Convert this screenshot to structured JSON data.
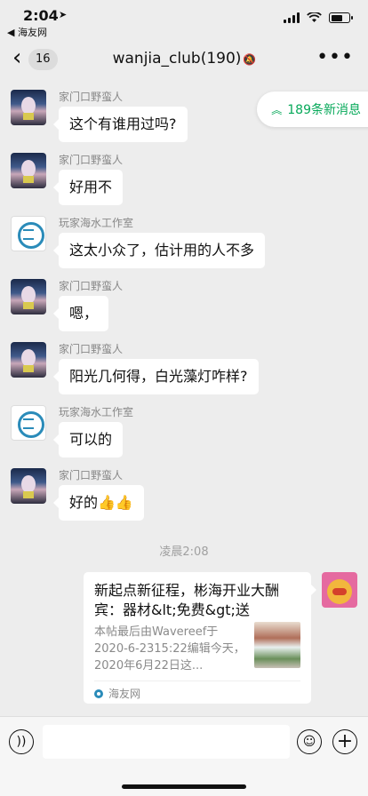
{
  "status_bar": {
    "time": "2:04",
    "back_app": "◀ 海友网"
  },
  "nav": {
    "back_count": "16",
    "title": "wanjia_club(190)",
    "more_icon": "more-dots-icon"
  },
  "new_messages": {
    "label": "189条新消息"
  },
  "messages": [
    {
      "sender": "家门口野蛮人",
      "text": "这个有谁用过吗?"
    },
    {
      "sender": "家门口野蛮人",
      "text": "好用不"
    },
    {
      "sender": "玩家海水工作室",
      "text": "这太小众了，估计用的人不多"
    },
    {
      "sender": "家门口野蛮人",
      "text": "嗯，"
    },
    {
      "sender": "家门口野蛮人",
      "text": "阳光几何得，白光藻灯咋样?"
    },
    {
      "sender": "玩家海水工作室",
      "text": "可以的"
    },
    {
      "sender": "家门口野蛮人",
      "text": "好的👍👍"
    }
  ],
  "timestamp": "凌晨2:08",
  "link_card": {
    "title": "新起点新征程，彬海开业大酬宾：器材&lt;免费&gt;送",
    "desc": "本帖最后由Wavereef于2020-6-2315:22编辑今天，2020年6月22日这...",
    "source": "海友网"
  },
  "colors": {
    "accent": "#07a95a",
    "background": "#ededed"
  }
}
